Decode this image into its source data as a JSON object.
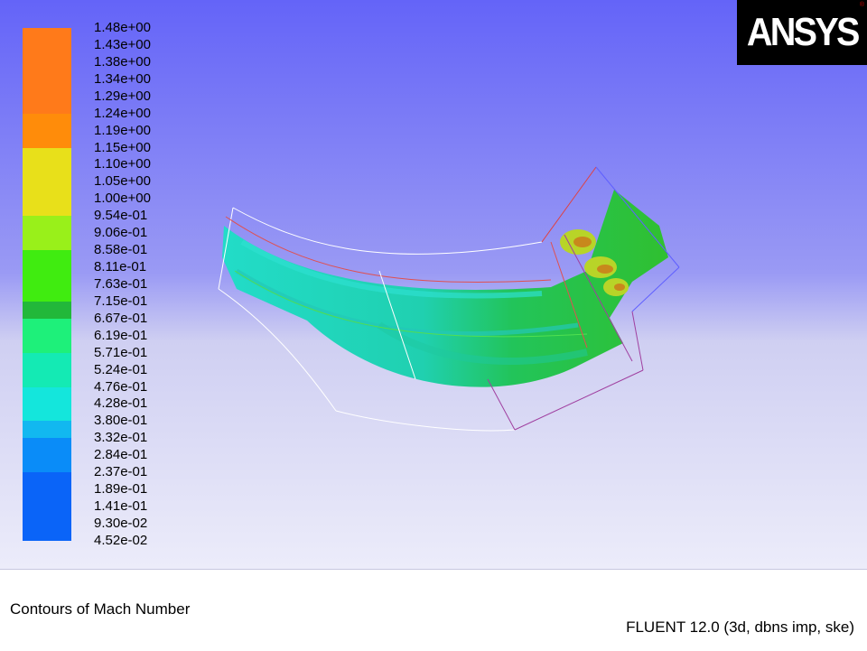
{
  "colorbar": {
    "labels": [
      "1.48e+00",
      "1.43e+00",
      "1.38e+00",
      "1.34e+00",
      "1.29e+00",
      "1.24e+00",
      "1.19e+00",
      "1.15e+00",
      "1.10e+00",
      "1.05e+00",
      "1.00e+00",
      "9.54e-01",
      "9.06e-01",
      "8.58e-01",
      "8.11e-01",
      "7.63e-01",
      "7.15e-01",
      "6.67e-01",
      "6.19e-01",
      "5.71e-01",
      "5.24e-01",
      "4.76e-01",
      "4.28e-01",
      "3.80e-01",
      "3.32e-01",
      "2.84e-01",
      "2.37e-01",
      "1.89e-01",
      "1.41e-01",
      "9.30e-02",
      "4.52e-02"
    ],
    "bands": [
      {
        "color": "#ff7a1a",
        "span": 5
      },
      {
        "color": "#ff8c0a",
        "span": 2
      },
      {
        "color": "#e8e01a",
        "span": 4
      },
      {
        "color": "#99f01a",
        "span": 2
      },
      {
        "color": "#40ec10",
        "span": 3
      },
      {
        "color": "#22b83a",
        "span": 1
      },
      {
        "color": "#1ef07a",
        "span": 2
      },
      {
        "color": "#14eab4",
        "span": 2
      },
      {
        "color": "#14e6dc",
        "span": 2
      },
      {
        "color": "#12b8f0",
        "span": 1
      },
      {
        "color": "#0a8cf8",
        "span": 2
      },
      {
        "color": "#0a64f8",
        "span": 4
      }
    ]
  },
  "logo": {
    "text": "ANSYS",
    "reg": "®"
  },
  "caption": {
    "left": "Contours of Mach Number",
    "right": "FLUENT 12.0 (3d, dbns imp, ske)"
  },
  "colors": {
    "footer_bg": "#ffffff",
    "logo_bg": "#000000"
  }
}
